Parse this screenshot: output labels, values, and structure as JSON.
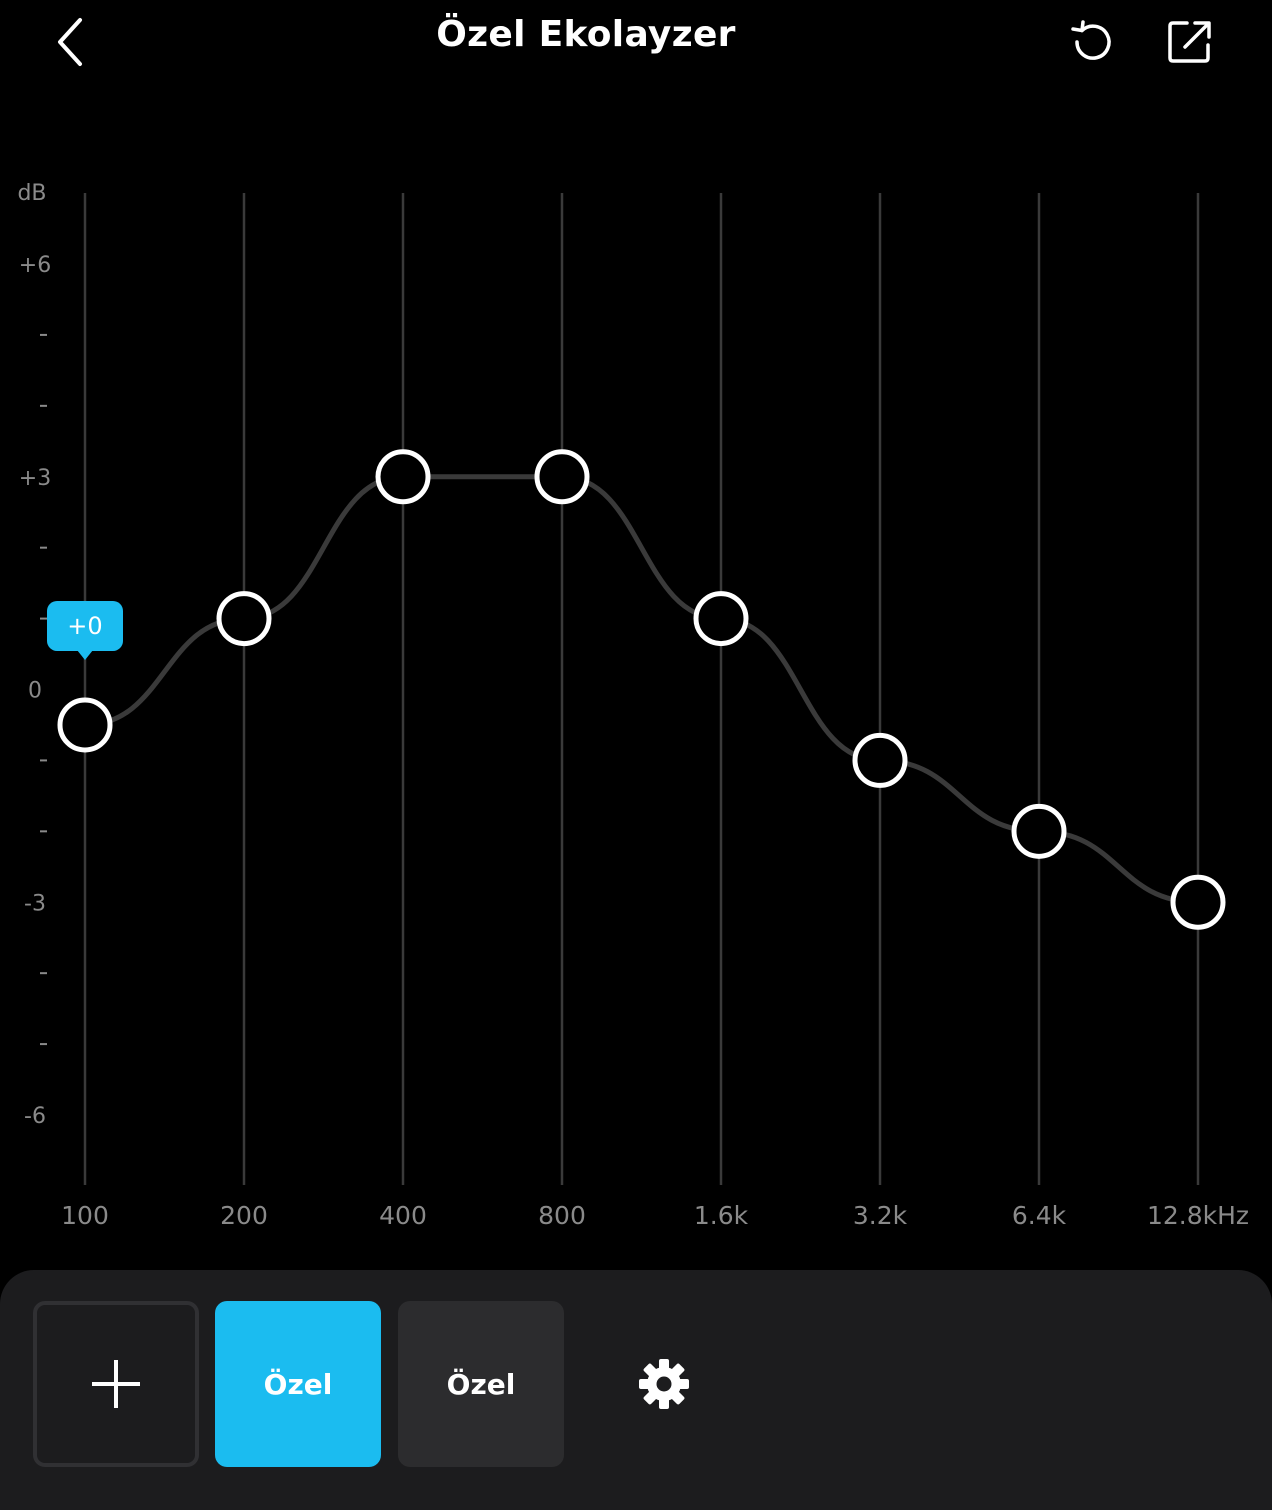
{
  "header": {
    "title": "Özel Ekolayzer",
    "back_icon": "chevron-left-icon",
    "reset_icon": "reset-icon",
    "share_icon": "share-icon"
  },
  "chart_data": {
    "type": "line",
    "y_unit_label": "dB",
    "y_tick_labels": [
      "+6",
      "+3",
      "0",
      "-3",
      "-6"
    ],
    "ylim": [
      -6,
      6
    ],
    "categories": [
      "100",
      "200",
      "400",
      "800",
      "1.6k",
      "3.2k",
      "6.4k",
      "12.8kHz"
    ],
    "series": [
      {
        "values": [
          -0.5,
          1,
          3,
          3,
          1,
          -1,
          -2,
          -3
        ]
      }
    ],
    "tooltip": {
      "band_index": 0,
      "text": "+0"
    },
    "colors": {
      "curve": "#3a3a3a",
      "grid": "#3a3a3a",
      "handle": "#ffffff",
      "tooltip": "#1bbcf0"
    }
  },
  "presets": {
    "add_icon": "plus-icon",
    "items": [
      {
        "label": "Özel",
        "active": true
      },
      {
        "label": "Özel",
        "active": false
      }
    ],
    "settings_icon": "gear-icon"
  }
}
